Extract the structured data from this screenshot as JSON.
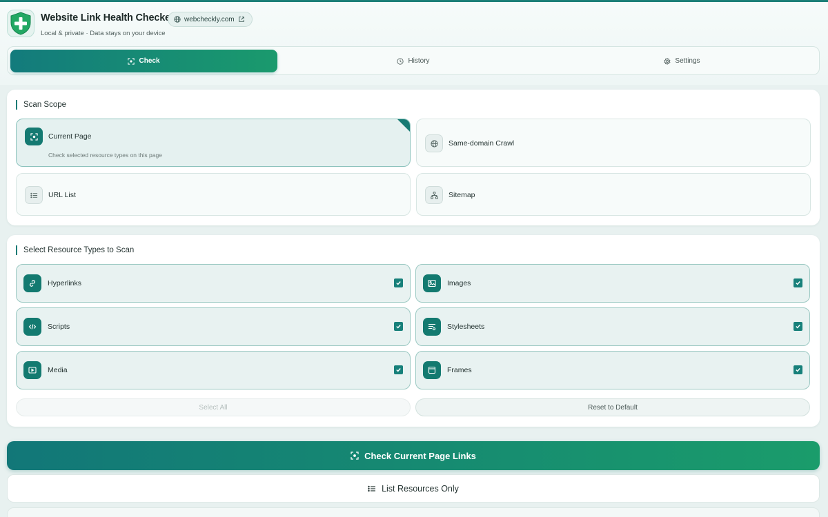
{
  "app": {
    "title": "Website Link Health Checker",
    "domain": "webcheckly.com",
    "subtitle": "Local & private · Data stays on your device"
  },
  "tabs": [
    {
      "label": "Check",
      "icon": "scan-icon",
      "active": true
    },
    {
      "label": "History",
      "icon": "clock-icon",
      "active": false
    },
    {
      "label": "Settings",
      "icon": "gear-icon",
      "active": false
    }
  ],
  "scan_scope": {
    "title": "Scan Scope",
    "options": [
      {
        "label": "Current Page",
        "description": "Check selected resource types on this page",
        "icon": "scan-icon",
        "selected": true
      },
      {
        "label": "Same-domain Crawl",
        "icon": "globe-icon",
        "selected": false
      },
      {
        "label": "URL List",
        "icon": "list-icon",
        "selected": false
      },
      {
        "label": "Sitemap",
        "icon": "sitemap-icon",
        "selected": false
      }
    ]
  },
  "resource_types": {
    "title": "Select Resource Types to Scan",
    "items": [
      {
        "label": "Hyperlinks",
        "icon": "link-icon",
        "checked": true
      },
      {
        "label": "Images",
        "icon": "image-icon",
        "checked": true
      },
      {
        "label": "Scripts",
        "icon": "code-icon",
        "checked": true
      },
      {
        "label": "Stylesheets",
        "icon": "stylesheet-icon",
        "checked": true
      },
      {
        "label": "Media",
        "icon": "media-icon",
        "checked": true
      },
      {
        "label": "Frames",
        "icon": "frame-icon",
        "checked": true
      }
    ],
    "select_all_label": "Select All",
    "reset_label": "Reset to Default"
  },
  "actions": {
    "primary_label": "Check Current Page Links",
    "secondary_label": "List Resources Only"
  },
  "colors": {
    "accent": "#137b7c",
    "accent_end": "#1a9a6d",
    "page_bg": "#e8f1f0"
  }
}
